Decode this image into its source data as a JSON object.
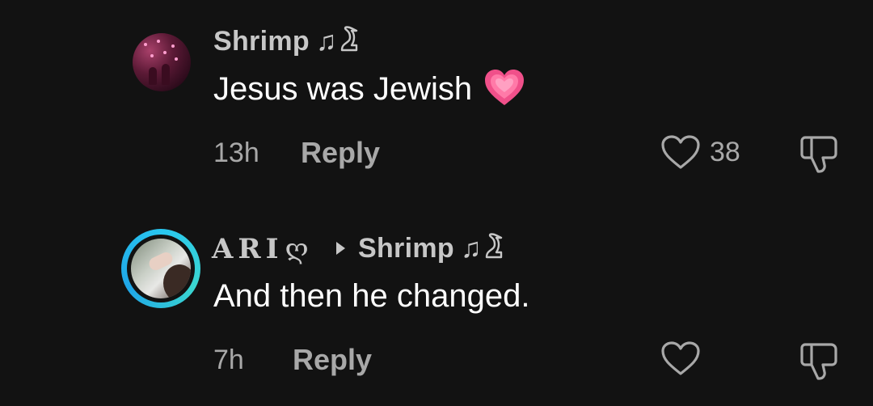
{
  "comments": [
    {
      "username": "Shrimp",
      "username_suffix": "♫",
      "text": "Jesus was Jewish",
      "emoji": "heart-emoji",
      "time": "13h",
      "reply_label": "Reply",
      "likes": "38"
    },
    {
      "username": "ARI",
      "username_suffix": "ღ",
      "reply_to": "Shrimp",
      "reply_to_suffix": "♫",
      "text": "And then he changed.",
      "time": "7h",
      "reply_label": "Reply",
      "likes": ""
    }
  ],
  "colors": {
    "background": "#121212",
    "secondary_text": "#a8a8a8",
    "username": "#c7c7c7",
    "story_ring": "#29c7f0",
    "heart_emoji": "#f0508a"
  },
  "icons": [
    "heart-icon",
    "thumbs-down-icon",
    "music-note-icon",
    "goose-icon",
    "arrow-right-icon"
  ]
}
